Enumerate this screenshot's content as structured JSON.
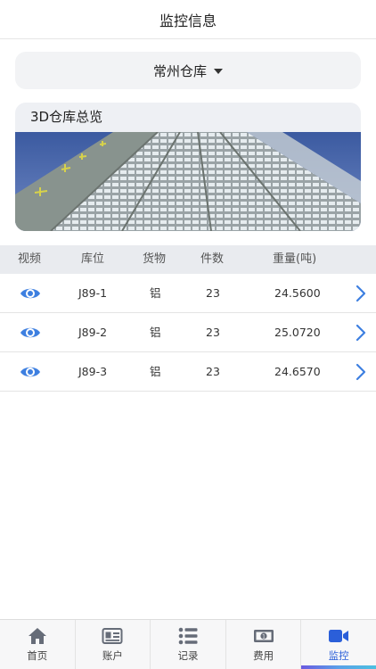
{
  "header": {
    "title": "监控信息"
  },
  "selector": {
    "warehouse": "常州仓库"
  },
  "overview": {
    "title": "3D仓库总览"
  },
  "table": {
    "columns": [
      "视频",
      "库位",
      "货物",
      "件数",
      "重量(吨)"
    ],
    "rows": [
      {
        "location": "J89-1",
        "goods": "铝",
        "count": "23",
        "weight": "24.5600"
      },
      {
        "location": "J89-2",
        "goods": "铝",
        "count": "23",
        "weight": "25.0720"
      },
      {
        "location": "J89-3",
        "goods": "铝",
        "count": "23",
        "weight": "24.6570"
      }
    ]
  },
  "tabbar": {
    "items": [
      {
        "label": "首页",
        "icon": "home-icon"
      },
      {
        "label": "账户",
        "icon": "id-card-icon"
      },
      {
        "label": "记录",
        "icon": "list-icon"
      },
      {
        "label": "费用",
        "icon": "money-icon"
      },
      {
        "label": "监控",
        "icon": "video-camera-icon"
      }
    ],
    "active": 4
  },
  "colors": {
    "accent": "#2b5fd9",
    "icon_blue": "#3d7fe0",
    "tab_icon_gray": "#666c78"
  }
}
